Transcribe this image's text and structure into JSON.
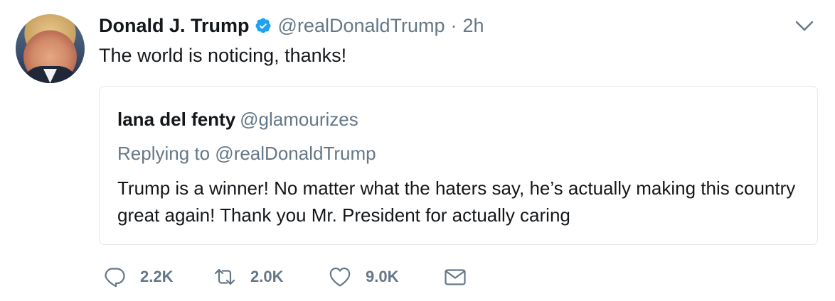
{
  "tweet": {
    "author_name": "Donald J. Trump",
    "author_handle": "@realDonaldTrump",
    "separator": "·",
    "time": "2h",
    "text": "The world is noticing, thanks!",
    "verified": true
  },
  "quoted": {
    "author_name": "lana del fenty",
    "author_handle": "@glamourizes",
    "replying_to": "Replying to @realDonaldTrump",
    "text": "Trump is a winner! No matter what the haters say, he’s actually making this country great again! Thank you Mr. President for actually caring"
  },
  "actions": {
    "reply_count": "2.2K",
    "retweet_count": "2.0K",
    "like_count": "9.0K"
  },
  "icons": {
    "verified": "verified-badge-icon",
    "caret": "chevron-down-icon",
    "reply": "reply-icon",
    "retweet": "retweet-icon",
    "like": "heart-icon",
    "dm": "envelope-icon"
  },
  "colors": {
    "text": "#14171a",
    "secondary": "#657786",
    "verified": "#1da1f2",
    "border": "#e1e8ed"
  }
}
